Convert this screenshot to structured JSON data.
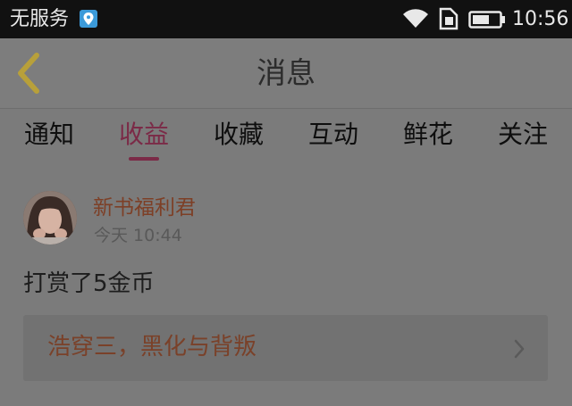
{
  "status_bar": {
    "carrier": "无服务",
    "time": "10:56"
  },
  "header": {
    "title": "消息"
  },
  "tabs": [
    {
      "label": "通知",
      "active": false
    },
    {
      "label": "收益",
      "active": true
    },
    {
      "label": "收藏",
      "active": false
    },
    {
      "label": "互动",
      "active": false
    },
    {
      "label": "鲜花",
      "active": false
    },
    {
      "label": "关注",
      "active": false
    }
  ],
  "message": {
    "sender": "新书福利君",
    "time": "今天 10:44",
    "text": "打赏了5金币",
    "book_title": "浩穿三，黑化与背叛"
  },
  "icons": {
    "back": "chevron-left-icon",
    "book_link": "chevron-right-icon",
    "status": [
      "location-icon",
      "wifi-icon",
      "sim-card-icon",
      "battery-icon"
    ]
  },
  "colors": {
    "accent": "#7b2a47",
    "back_arrow": "#b8a03a",
    "sender_name": "#7d3f26"
  }
}
